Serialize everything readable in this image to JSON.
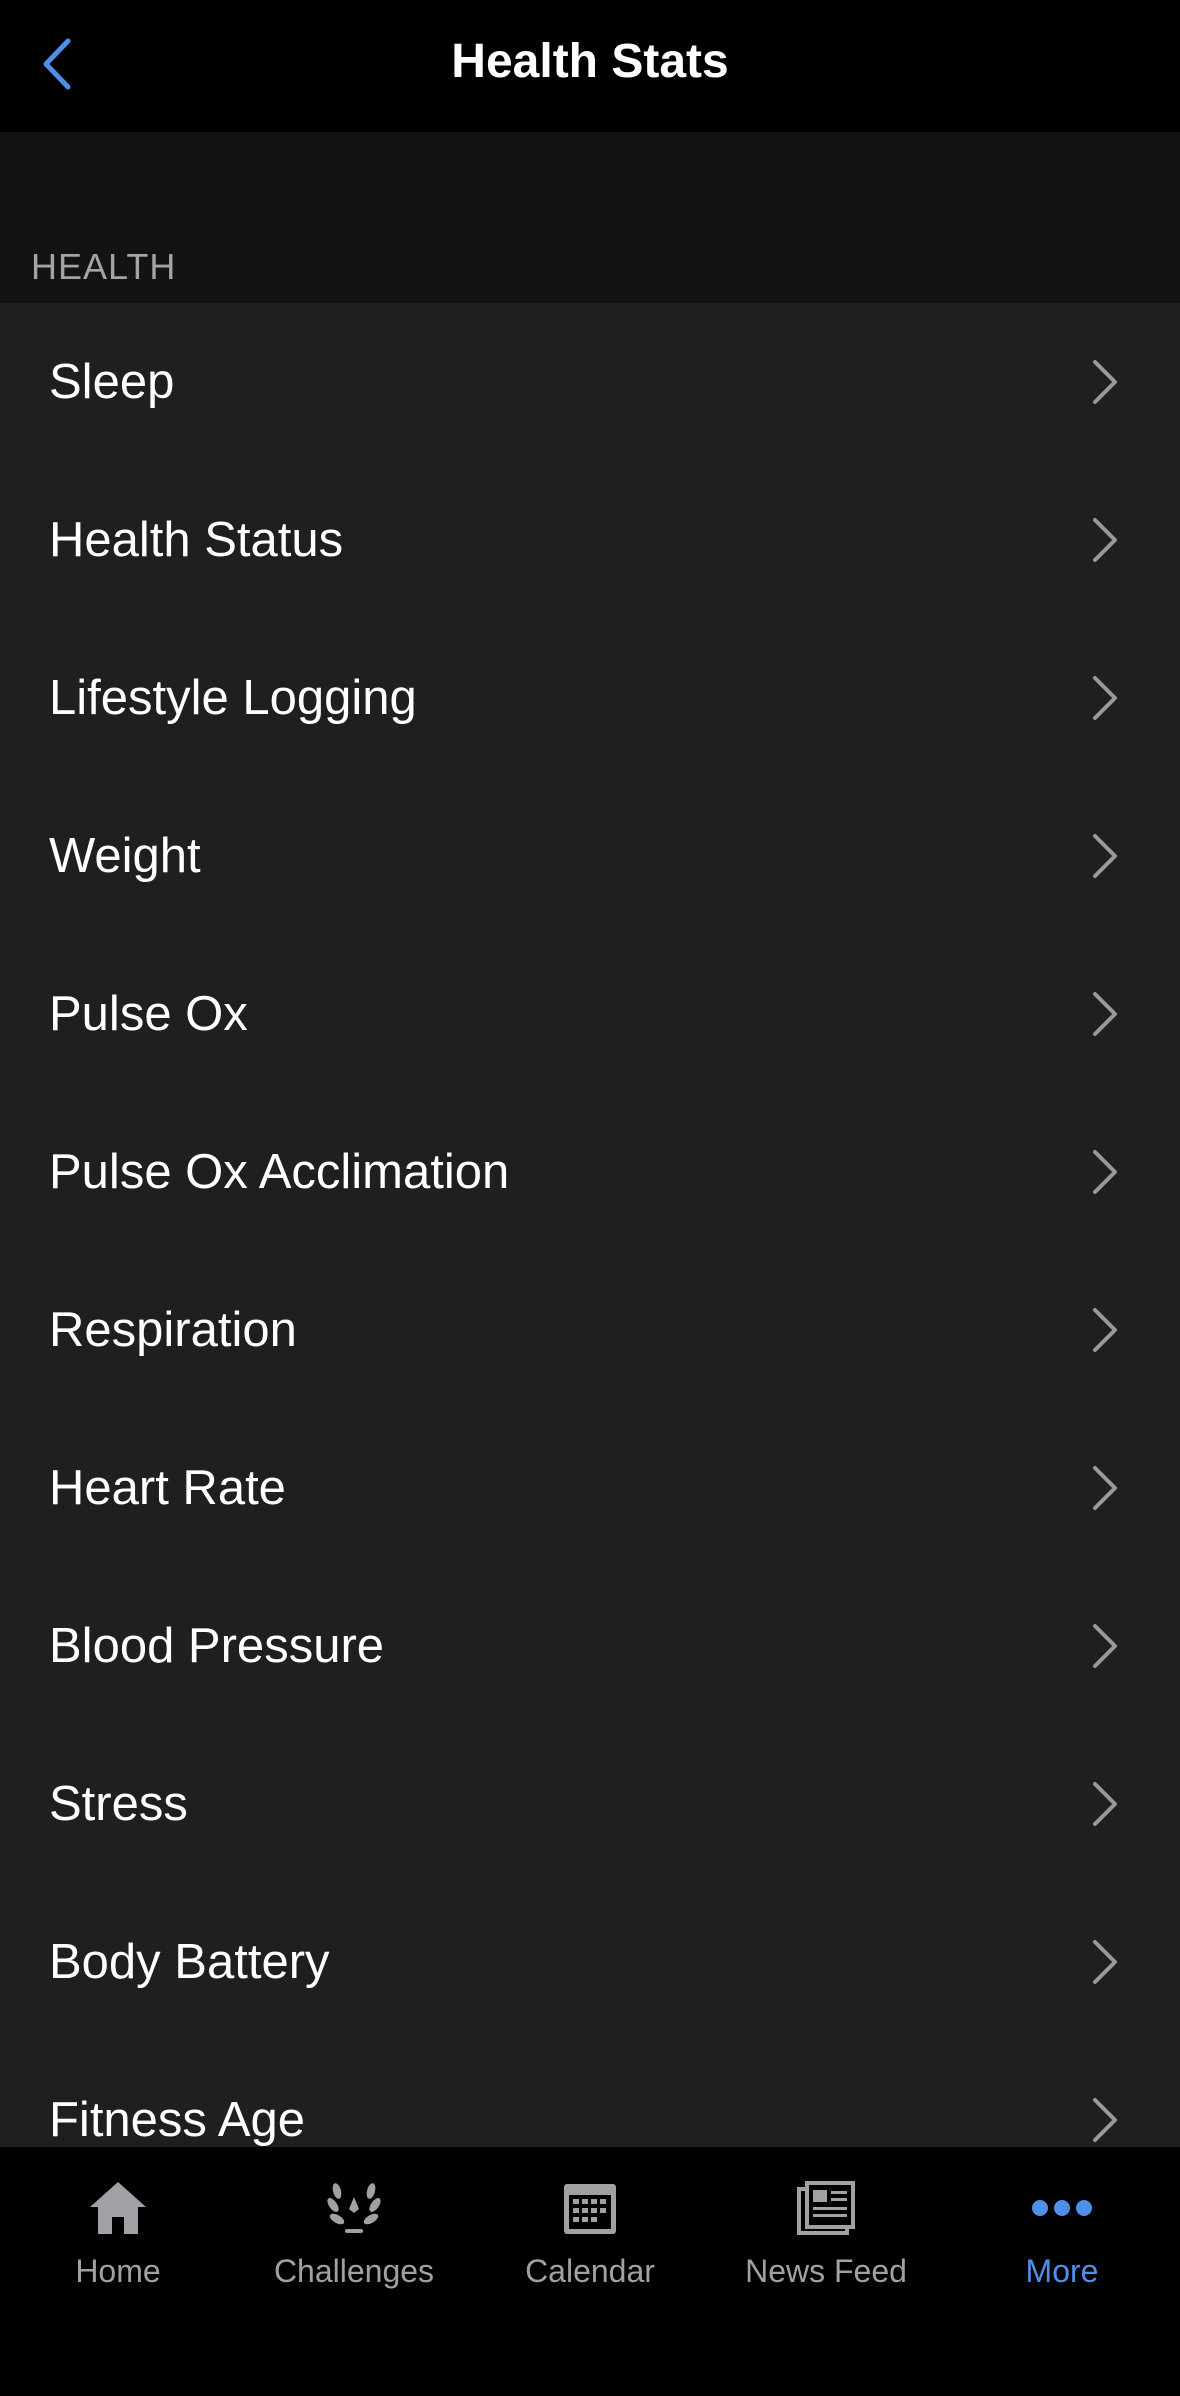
{
  "header": {
    "title": "Health Stats",
    "back_icon": "chevron-left-icon"
  },
  "section": {
    "title": "HEALTH"
  },
  "items": [
    {
      "label": "Sleep"
    },
    {
      "label": "Health Status"
    },
    {
      "label": "Lifestyle Logging"
    },
    {
      "label": "Weight"
    },
    {
      "label": "Pulse Ox"
    },
    {
      "label": "Pulse Ox Acclimation"
    },
    {
      "label": "Respiration"
    },
    {
      "label": "Heart Rate"
    },
    {
      "label": "Blood Pressure"
    },
    {
      "label": "Stress"
    },
    {
      "label": "Body Battery"
    },
    {
      "label": "Fitness Age"
    }
  ],
  "tabbar": {
    "tabs": [
      {
        "label": "Home",
        "icon": "home-icon",
        "active": false
      },
      {
        "label": "Challenges",
        "icon": "laurel-icon",
        "active": false
      },
      {
        "label": "Calendar",
        "icon": "calendar-icon",
        "active": false
      },
      {
        "label": "News Feed",
        "icon": "newspaper-icon",
        "active": false
      },
      {
        "label": "More",
        "icon": "more-dots-icon",
        "active": true
      }
    ]
  },
  "colors": {
    "accent": "#4f8fe8",
    "background": "#000000",
    "row_background": "#1f1f1f",
    "section_background": "#131313",
    "secondary_text": "#a3a3a8"
  }
}
